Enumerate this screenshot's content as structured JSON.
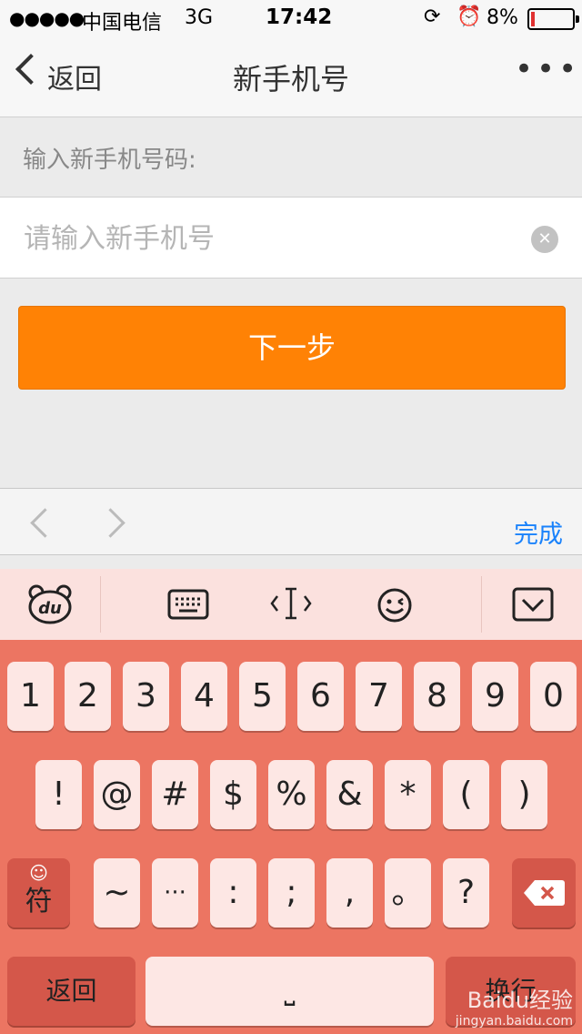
{
  "status": {
    "signal": "●●●●●",
    "carrier": "中国电信",
    "network": "3G",
    "time": "17:42",
    "battery": "8%"
  },
  "nav": {
    "back_label": "返回",
    "title": "新手机号",
    "more": "•••"
  },
  "form": {
    "prompt": "输入新手机号码:",
    "phone_placeholder": "请输入新手机号",
    "phone_value": "",
    "next_label": "下一步"
  },
  "accessory": {
    "done_label": "完成"
  },
  "keyboard": {
    "row1": [
      "1",
      "2",
      "3",
      "4",
      "5",
      "6",
      "7",
      "8",
      "9",
      "0"
    ],
    "row2": [
      "!",
      "@",
      "#",
      "$",
      "%",
      "&",
      "*",
      "(",
      ")"
    ],
    "row3": [
      "~",
      "···",
      ":",
      ";",
      ",",
      "。",
      "?"
    ],
    "symbol_label": "符",
    "symbol_emoji": "☺",
    "return_label": "返回",
    "space_label": "⎵",
    "action_label": "换行"
  },
  "watermark": {
    "text": "Baidu经验",
    "url": "jingyan.baidu.com"
  },
  "colors": {
    "accent": "#ff8205",
    "done": "#1a82fb",
    "keyboard_bg": "#ec7562",
    "key_bg": "#fde7e4"
  }
}
